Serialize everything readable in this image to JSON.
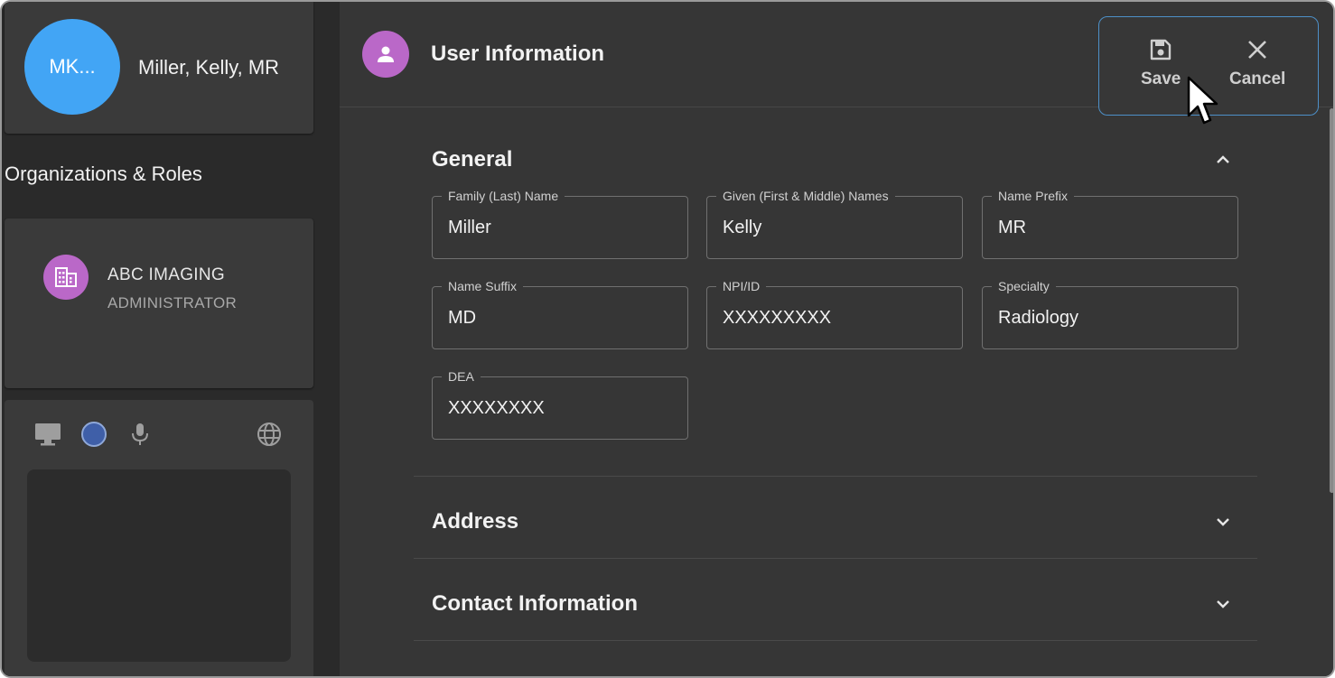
{
  "user": {
    "avatar_initials": "MK...",
    "display_name": "Miller, Kelly, MR"
  },
  "sidebar": {
    "section_title": "Organizations & Roles",
    "organization": {
      "name": "ABC IMAGING",
      "role": "ADMINISTRATOR",
      "icon": "domain-icon"
    },
    "media_controls": {
      "icons": [
        "monitor-icon",
        "status-circle-icon",
        "microphone-icon",
        "globe-icon"
      ]
    }
  },
  "header": {
    "title": "User Information",
    "icon": "person-icon",
    "save_label": "Save",
    "cancel_label": "Cancel"
  },
  "sections": {
    "general": {
      "title": "General",
      "expanded": true,
      "fields": {
        "family_name": {
          "label": "Family (Last) Name",
          "value": "Miller"
        },
        "given_names": {
          "label": "Given (First & Middle) Names",
          "value": "Kelly"
        },
        "name_prefix": {
          "label": "Name Prefix",
          "value": "MR"
        },
        "name_suffix": {
          "label": "Name Suffix",
          "value": "MD"
        },
        "npi_id": {
          "label": "NPI/ID",
          "value": "XXXXXXXXX"
        },
        "specialty": {
          "label": "Specialty",
          "value": "Radiology"
        },
        "dea": {
          "label": "DEA",
          "value": "XXXXXXXX"
        }
      }
    },
    "address": {
      "title": "Address",
      "expanded": false
    },
    "contact": {
      "title": "Contact Information",
      "expanded": false
    }
  },
  "colors": {
    "avatar_blue": "#42a5f5",
    "accent_purple": "#ba68c8",
    "action_border": "#4d90c8"
  }
}
